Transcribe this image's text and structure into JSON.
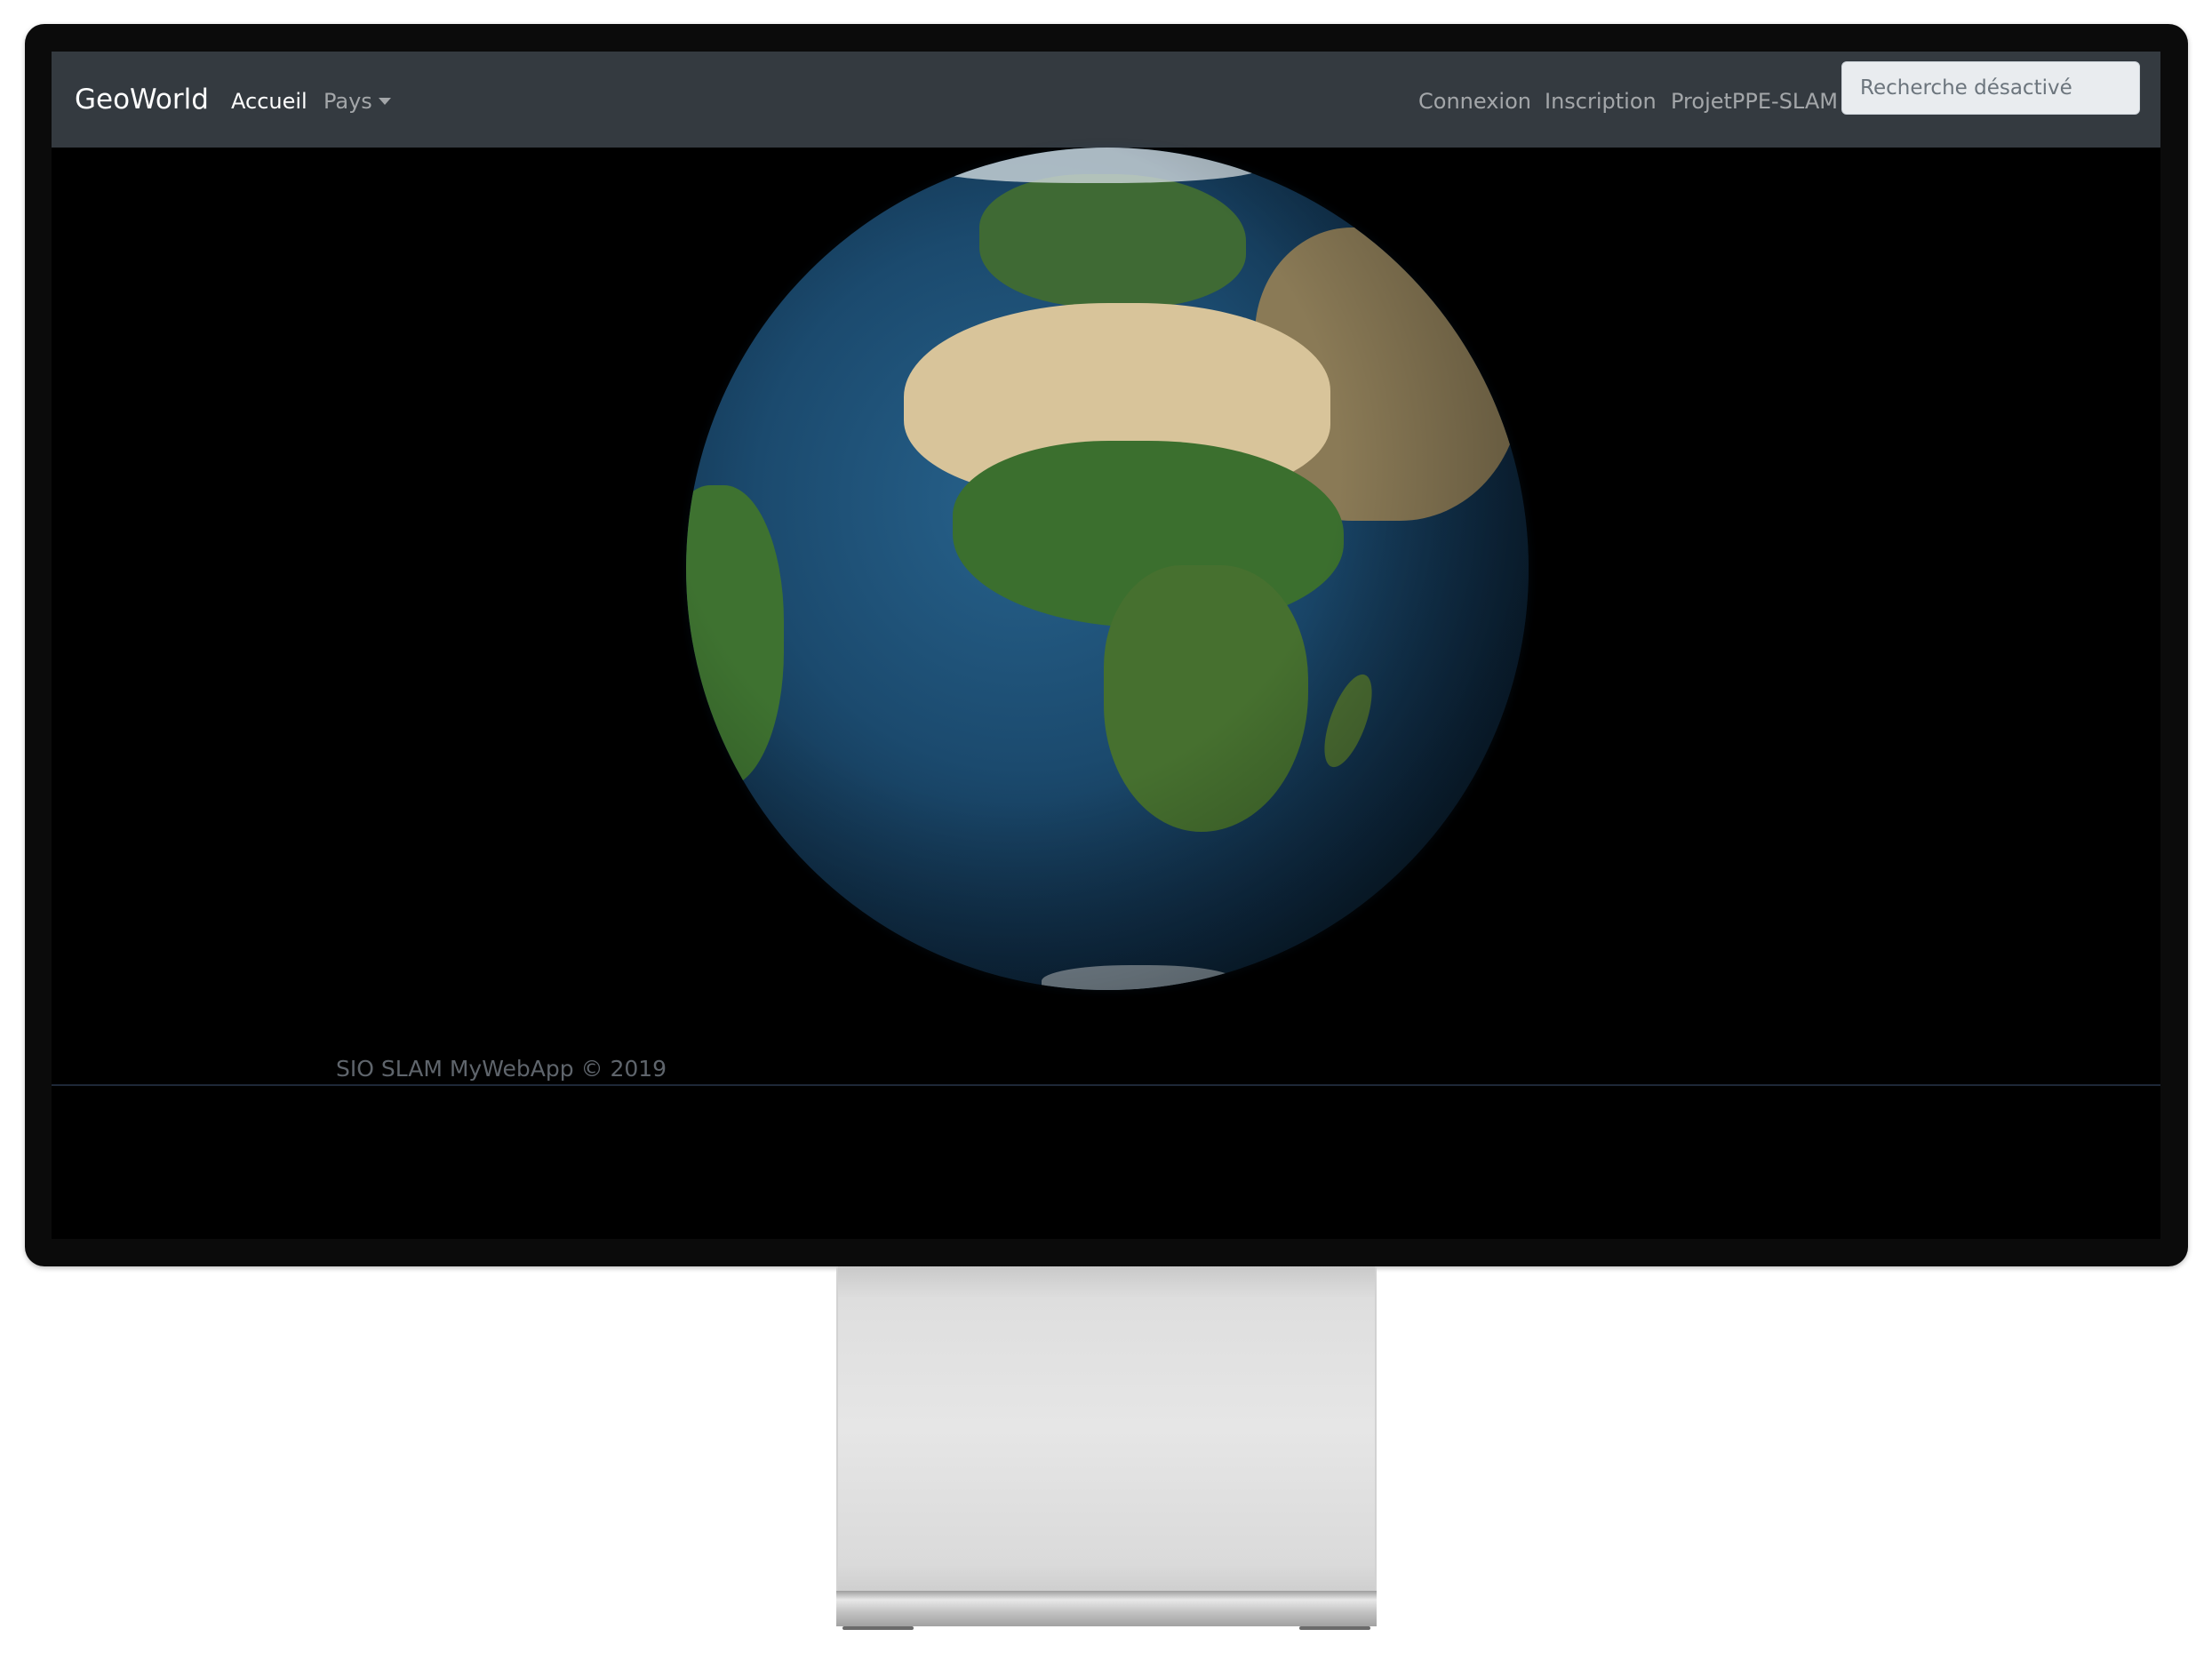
{
  "navbar": {
    "brand": "GeoWorld",
    "links": [
      {
        "label": "Accueil",
        "active": true
      },
      {
        "label": "Pays",
        "dropdown": true
      }
    ],
    "right_links": [
      {
        "label": "Connexion"
      },
      {
        "label": "Inscription"
      },
      {
        "label": "ProjetPPE-SLAM"
      }
    ],
    "search": {
      "placeholder": "Recherche désactivé",
      "value": ""
    }
  },
  "footer": {
    "text": "SIO SLAM MyWebApp © 2019"
  },
  "colors": {
    "navbar_bg": "#343a40",
    "page_bg": "#000000",
    "ocean": "#1b4a6e",
    "desert": "#d8c49a",
    "vegetation": "#3b6f2e"
  },
  "icons": {
    "dropdown": "caret-down-icon"
  }
}
